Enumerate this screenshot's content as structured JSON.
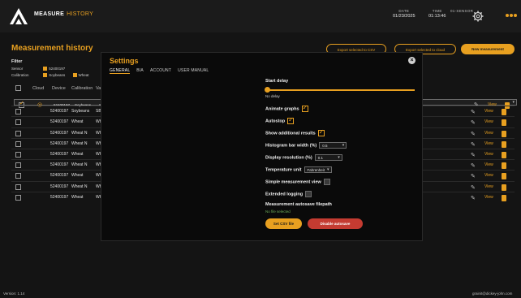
{
  "app": {
    "brand_main": "MEASURE",
    "brand_sub": "HISTORY"
  },
  "topbar": {
    "date_label": "DATE",
    "date_value": "01/23/2025",
    "time_label": "TIME",
    "time_value": "01:13:46",
    "device_label": "01-SENSOR",
    "icons": [
      "app-logo",
      "gear-icon",
      "window-dots"
    ]
  },
  "page": {
    "title": "Measurement history",
    "buttons": {
      "export_csv": "Export selected to CSV",
      "export_cloud": "Export selected to cloud",
      "new_measurement": "New measurement"
    },
    "filter": {
      "title": "Filter",
      "sensor_label": "Sensor",
      "sensor_chip": "52400197",
      "calibration_label": "Calibration",
      "calibration_chips": [
        "Soybeans",
        "Wheat"
      ]
    }
  },
  "table": {
    "columns": [
      "Cloud",
      "Device",
      "Calibration",
      "Var"
    ],
    "view_label": "View",
    "rows": [
      {
        "cloud": true,
        "device": "52400197",
        "calibration": "Soybeans",
        "var": "SBN",
        "selected": true
      },
      {
        "cloud": false,
        "device": "52400197",
        "calibration": "Soybeans",
        "var": "SBN",
        "selected": false
      },
      {
        "cloud": false,
        "device": "52400197",
        "calibration": "Wheat",
        "var": "WH",
        "selected": false
      },
      {
        "cloud": false,
        "device": "52400197",
        "calibration": "Wheat N",
        "var": "WH",
        "selected": false
      },
      {
        "cloud": false,
        "device": "52400197",
        "calibration": "Wheat N",
        "var": "WH",
        "selected": false
      },
      {
        "cloud": false,
        "device": "52400197",
        "calibration": "Wheat",
        "var": "WH",
        "selected": false
      },
      {
        "cloud": false,
        "device": "52400197",
        "calibration": "Wheat N",
        "var": "WH",
        "selected": false
      },
      {
        "cloud": false,
        "device": "52400197",
        "calibration": "Wheat",
        "var": "WH",
        "selected": false
      },
      {
        "cloud": false,
        "device": "52400197",
        "calibration": "Wheat N",
        "var": "WH",
        "selected": false
      },
      {
        "cloud": false,
        "device": "52400197",
        "calibration": "Wheat",
        "var": "WH",
        "selected": false
      }
    ]
  },
  "footer": {
    "version": "Version: 1.14",
    "user": "grainit@dickey-john.com"
  },
  "settings": {
    "title": "Settings",
    "tabs": [
      "GENERAL",
      "BIA",
      "ACCOUNT",
      "USER MANUAL"
    ],
    "active_tab": 0,
    "start_delay_label": "Start delay",
    "start_delay_value": "No delay",
    "animate_graphs_label": "Animate graphs",
    "animate_graphs": true,
    "autostop_label": "Autostop",
    "autostop": true,
    "show_additional_label": "Show additional results",
    "show_additional": true,
    "hist_bar_label": "Histogram bar width (%)",
    "hist_bar_value": "0.5",
    "display_res_label": "Display resolution (%)",
    "display_res_value": "0.1",
    "temp_unit_label": "Temperature unit",
    "temp_unit_value": "Fahrenheit",
    "simple_view_label": "Simple measurement view",
    "simple_view": false,
    "extended_logging_label": "Extended logging",
    "extended_logging": false,
    "autosave_label": "Measurement autosave filepath",
    "autosave_value": "No file selected",
    "set_csv_button": "Set CSV file",
    "disable_autosave_button": "Disable autosave"
  },
  "colors": {
    "accent": "#e8a020",
    "danger": "#c43b31",
    "path_ok": "#6fae5b",
    "bg": "#141414"
  }
}
